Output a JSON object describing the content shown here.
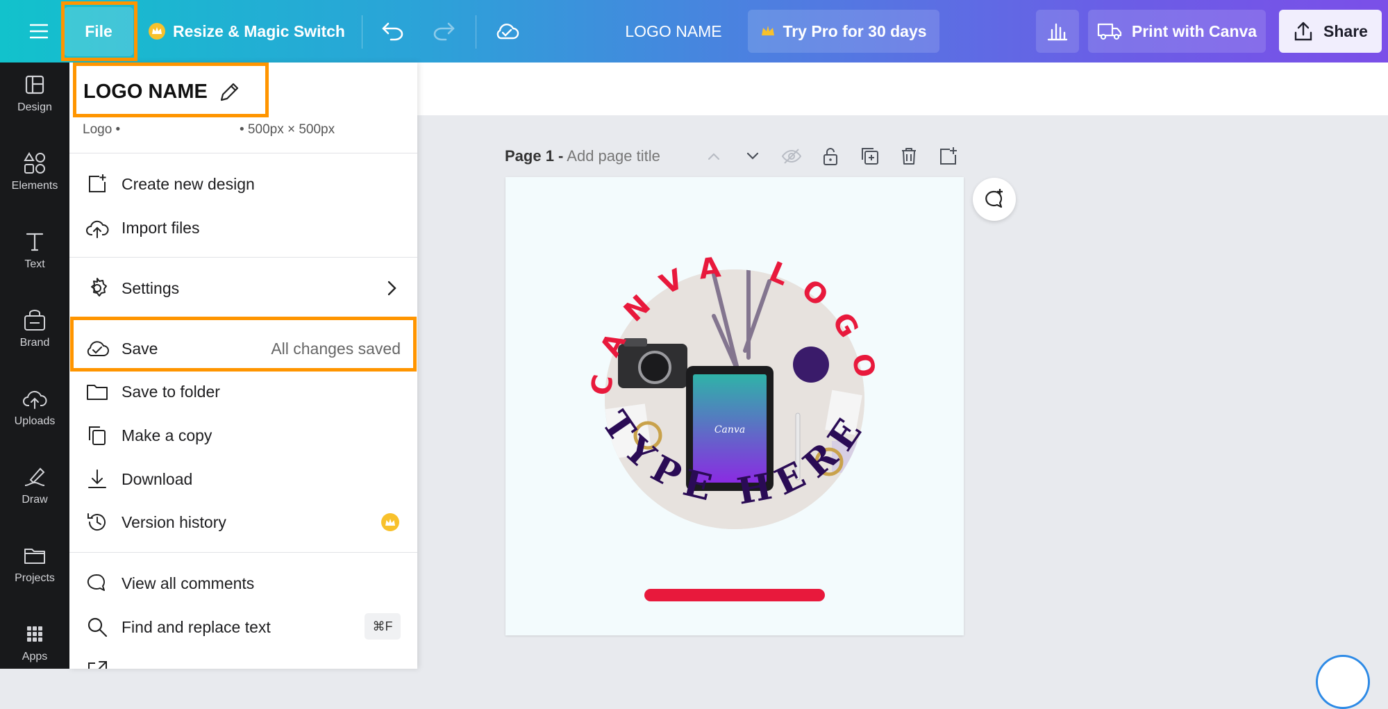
{
  "colors": {
    "accent_orange": "#ff9500",
    "brand_red": "#e8193c",
    "brand_purple": "#2a0b55"
  },
  "topbar": {
    "file_label": "File",
    "resize_label": "Resize & Magic Switch",
    "design_title": "LOGO NAME",
    "trypro_label": "Try Pro for 30 days",
    "print_label": "Print with Canva",
    "share_label": "Share",
    "icons": [
      "menu-icon",
      "crown-icon",
      "undo-icon",
      "redo-icon",
      "cloud-check-icon",
      "bar-chart-icon",
      "truck-icon",
      "share-upload-icon"
    ]
  },
  "rail": {
    "items": [
      {
        "label": "Design",
        "icon": "layout-icon"
      },
      {
        "label": "Elements",
        "icon": "shapes-icon"
      },
      {
        "label": "Text",
        "icon": "text-icon"
      },
      {
        "label": "Brand",
        "icon": "brand-icon"
      },
      {
        "label": "Uploads",
        "icon": "cloud-upload-icon"
      },
      {
        "label": "Draw",
        "icon": "pen-icon"
      },
      {
        "label": "Projects",
        "icon": "folder-icon"
      },
      {
        "label": "Apps",
        "icon": "grid-icon"
      }
    ]
  },
  "menu": {
    "title": "LOGO NAME",
    "meta_type": "Logo •",
    "meta_size": "• 500px × 500px",
    "create_new": "Create new design",
    "import_files": "Import files",
    "settings": "Settings",
    "save": "Save",
    "save_status": "All changes saved",
    "save_to_folder": "Save to folder",
    "make_copy": "Make a copy",
    "download": "Download",
    "version_history": "Version history",
    "view_comments": "View all comments",
    "find_replace": "Find and replace text",
    "find_shortcut": "⌘F"
  },
  "page": {
    "label": "Page 1 -",
    "title_placeholder": "Add page title",
    "logo_top_text": "CANVA LOGO",
    "logo_bottom_text": "TYPE HERE",
    "tablet_text": "Canva"
  }
}
